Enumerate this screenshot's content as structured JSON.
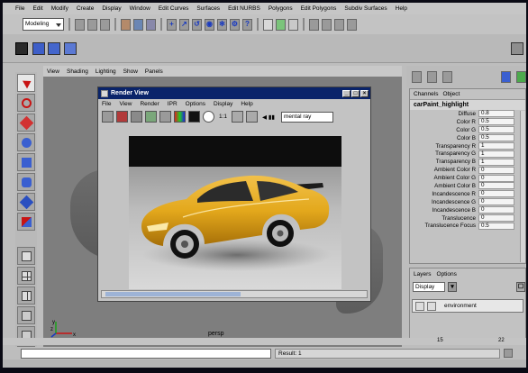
{
  "menubar": {
    "items": [
      "File",
      "Edit",
      "Modify",
      "Create",
      "Display",
      "Window",
      "Edit Curves",
      "Surfaces",
      "Edit NURBS",
      "Polygons",
      "Edit Polygons",
      "Subdiv Surfaces",
      "Help"
    ]
  },
  "status_line": {
    "mode": "Modeling"
  },
  "viewport": {
    "menu": [
      "View",
      "Shading",
      "Lighting",
      "Show",
      "Panels"
    ],
    "camera_label": "persp",
    "axis_x": "x",
    "axis_y": "y",
    "axis_z": "z"
  },
  "render_view": {
    "title": "Render View",
    "menu": [
      "File",
      "View",
      "Render",
      "IPR",
      "Options",
      "Display",
      "Help"
    ],
    "ratio_label": "1:1",
    "renderer": "mental ray"
  },
  "channel_box": {
    "tabs": [
      "Channels",
      "Object"
    ],
    "object_name": "carPaint_highlight",
    "attributes": [
      {
        "label": "Diffuse",
        "value": "0.8"
      },
      {
        "label": "Color R",
        "value": "0.5"
      },
      {
        "label": "Color G",
        "value": "0.5"
      },
      {
        "label": "Color B",
        "value": "0.5"
      },
      {
        "label": "Transparency R",
        "value": "1"
      },
      {
        "label": "Transparency G",
        "value": "1"
      },
      {
        "label": "Transparency B",
        "value": "1"
      },
      {
        "label": "Ambient Color R",
        "value": "0"
      },
      {
        "label": "Ambient Color G",
        "value": "0"
      },
      {
        "label": "Ambient Color B",
        "value": "0"
      },
      {
        "label": "Incandescence R",
        "value": "0"
      },
      {
        "label": "Incandescence G",
        "value": "0"
      },
      {
        "label": "Incandescence B",
        "value": "0"
      },
      {
        "label": "Translucence",
        "value": "0"
      },
      {
        "label": "Translucence Focus",
        "value": "0.5"
      }
    ]
  },
  "layer_editor": {
    "menu": [
      "Layers",
      "Options"
    ],
    "display_select": "Display",
    "layer_name": "environment"
  },
  "time_slider": {
    "start": "15",
    "end": "22"
  },
  "command_line": {
    "result": "Result: 1"
  },
  "colors": {
    "title_bar": "#0a246a",
    "car_paint": "#e3a81c",
    "ui_gray": "#bdbdbd"
  }
}
